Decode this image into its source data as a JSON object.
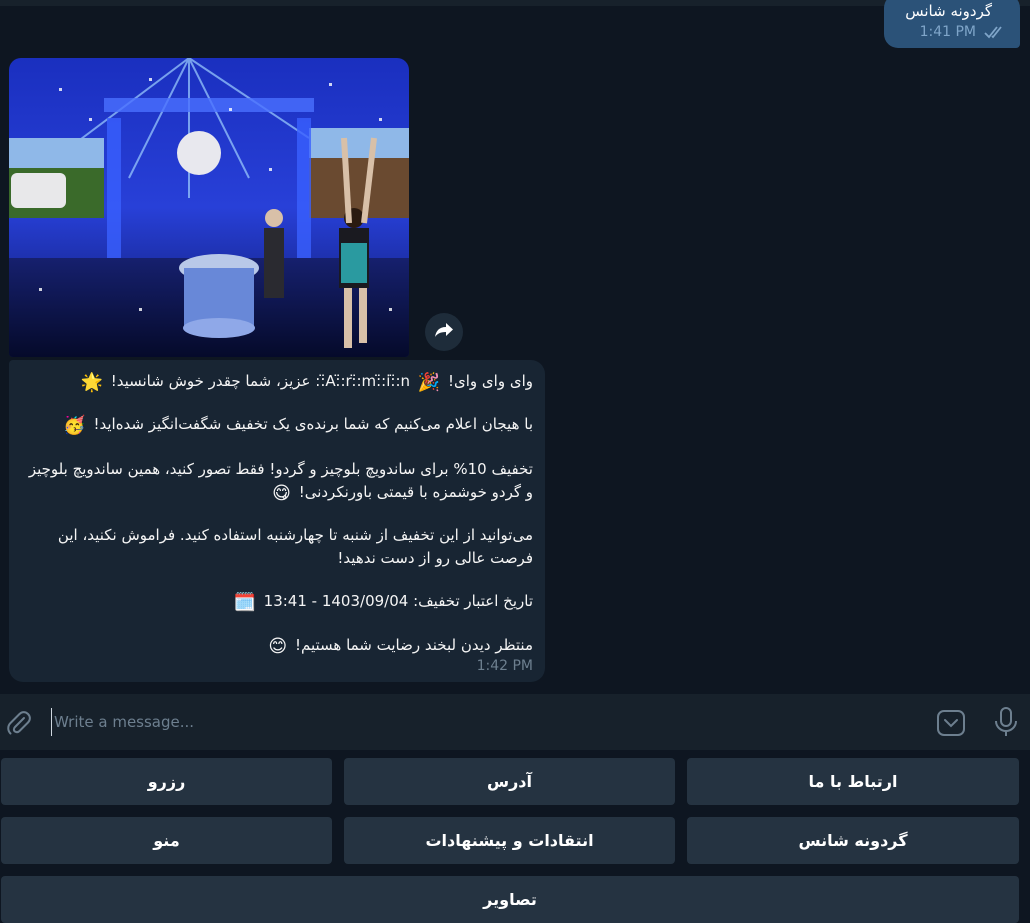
{
  "outgoing": {
    "text": "گردونه شانس",
    "time": "1:41 PM",
    "status_icon": "double-check-icon"
  },
  "photo": {
    "icon": "forward-icon"
  },
  "incoming": {
    "lines": [
      {
        "text": "وای وای وای! ",
        "emoji_after": "🎉",
        "rest": " A:̈:r:̈:m:̈:i:̈:n:̈: عزیز، شما چقدر خوش شانسید! ",
        "emoji_end": "🌟"
      },
      {
        "text": "با هیجان اعلام می‌کنیم که شما برنده‌ی یک تخفیف شگفت‌انگیز شده‌اید! ",
        "emoji_end": "🥳"
      },
      {
        "text": "تخفیف 10% برای ساندویچ بلوچیز و گردو! فقط تصور کنید، همین ساندویچ بلوچیز"
      },
      {
        "text": "و گردو خوشمزه با قیمتی باورنکردنی! ",
        "emoji_end": "😋"
      },
      {
        "text": "می‌توانید از این تخفیف از شنبه تا چهارشنبه استفاده کنید. فراموش نکنید، این"
      },
      {
        "text": "فرصت عالی رو از دست ندهید!"
      },
      {
        "text": "تاریخ اعتبار تخفیف: 1403/09/04 - 13:41 ",
        "emoji_end": "🗓️"
      },
      {
        "text": "منتظر دیدن لبخند رضایت شما هستیم! ",
        "emoji_end": "😊"
      }
    ],
    "time": "1:42 PM"
  },
  "composer": {
    "placeholder": "Write a message...",
    "attach_icon": "paperclip-icon",
    "emoji_icon": "sticker-icon",
    "mic_icon": "microphone-icon"
  },
  "keyboard": {
    "rows": [
      [
        "رزرو",
        "آدرس",
        "ارتباط با ما"
      ],
      [
        "منو",
        "انتقادات و پیشنهادات",
        "گردونه شانس"
      ],
      [
        "تصاویر"
      ]
    ]
  },
  "colors": {
    "background": "#0e1621",
    "outgoing_bubble": "#2b5278",
    "incoming_bubble": "#182533",
    "keyboard_button": "#253341",
    "composer": "#17212b"
  }
}
